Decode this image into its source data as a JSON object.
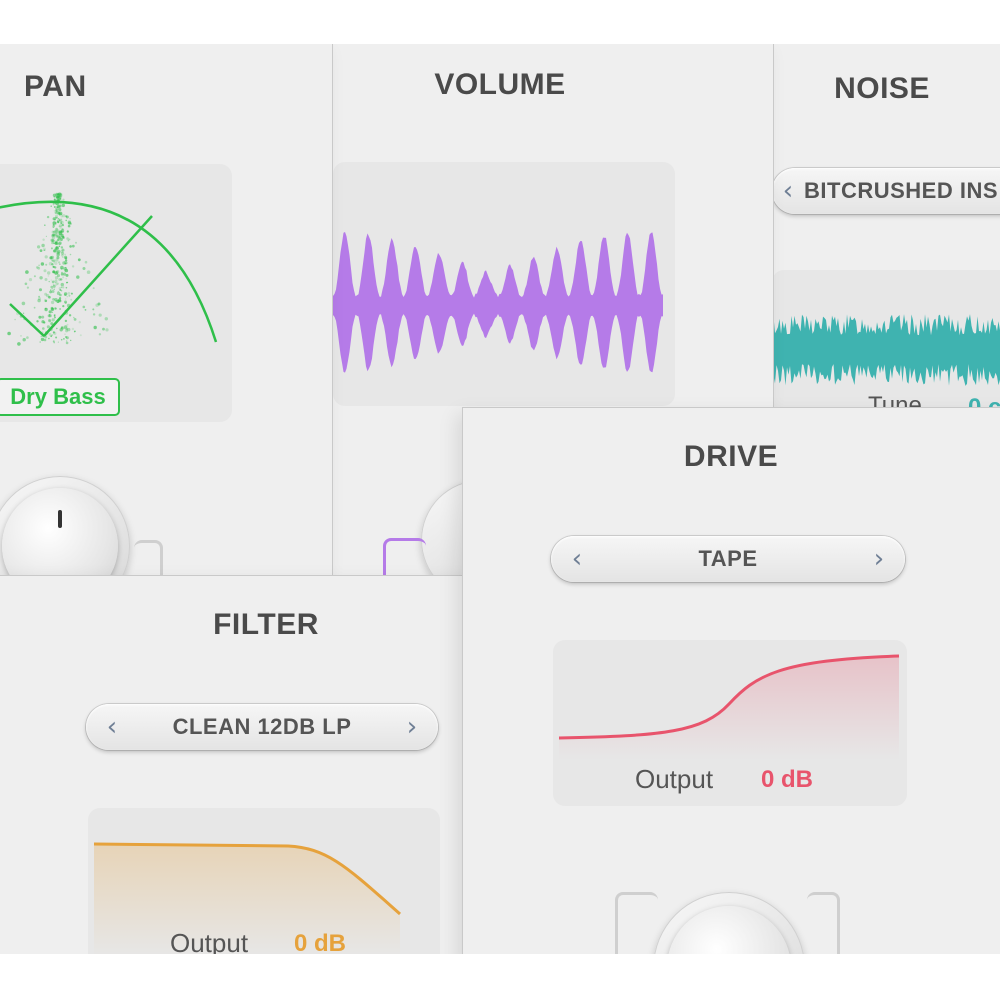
{
  "colors": {
    "pan": "#2fbf4a",
    "volume": "#b57be8",
    "noise": "#3fb3b0",
    "filter": "#e6a23c",
    "drive": "#e8546c"
  },
  "pan": {
    "title": "PAN",
    "source_label": "Dry Bass",
    "knob_value_pct": 50
  },
  "volume": {
    "title": "VOLUME"
  },
  "noise": {
    "title": "NOISE",
    "preset": "BITCRUSHED INS",
    "tune_label": "Tune",
    "tune_value": "0 c",
    "prev_icon": "chevron-left-icon"
  },
  "filter": {
    "title": "FILTER",
    "preset": "CLEAN 12DB LP",
    "output_label": "Output",
    "output_value": "0 dB",
    "prev_icon": "chevron-left-icon",
    "next_icon": "chevron-right-icon"
  },
  "drive": {
    "title": "DRIVE",
    "preset": "TAPE",
    "output_label": "Output",
    "output_value": "0 dB",
    "prev_icon": "chevron-left-icon",
    "next_icon": "chevron-right-icon"
  }
}
